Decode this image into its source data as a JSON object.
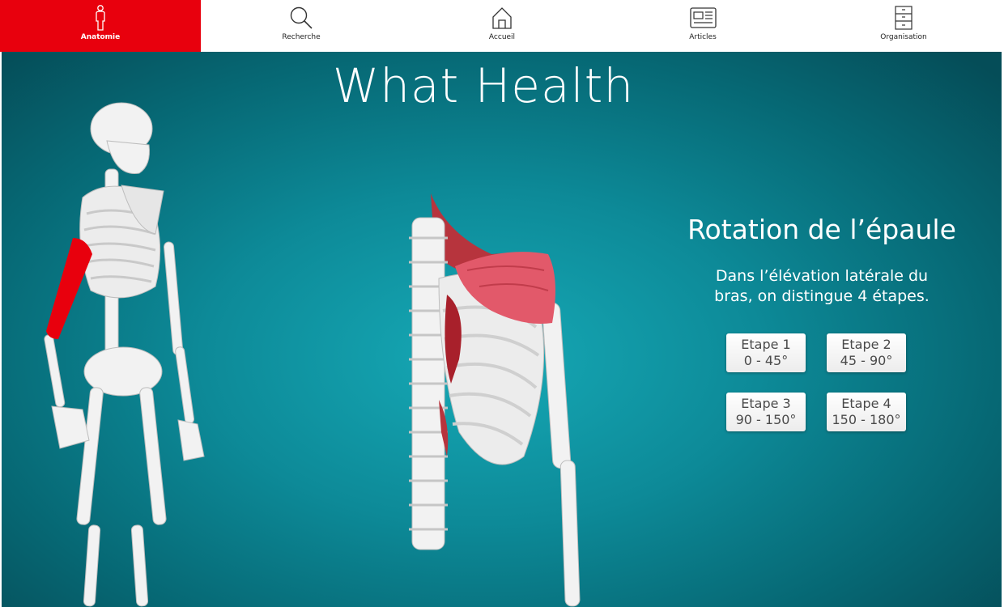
{
  "nav": {
    "items": [
      {
        "label": "Anatomie",
        "icon": "person-icon",
        "active": true
      },
      {
        "label": "Recherche",
        "icon": "search-icon",
        "active": false
      },
      {
        "label": "Accueil",
        "icon": "home-icon",
        "active": false
      },
      {
        "label": "Articles",
        "icon": "newspaper-icon",
        "active": false
      },
      {
        "label": "Organisation",
        "icon": "cabinet-icon",
        "active": false
      }
    ]
  },
  "scene": {
    "title": "What Health",
    "topic_title": "Rotation de l’épaule",
    "description_line1": "Dans l’élévation latérale du",
    "description_line2": "bras, on distingue 4 étapes.",
    "steps": [
      {
        "name": "Etape 1",
        "range": "0 - 45°"
      },
      {
        "name": "Etape 2",
        "range": "45 - 90°"
      },
      {
        "name": "Etape 3",
        "range": "90 - 150°"
      },
      {
        "name": "Etape 4",
        "range": "150 - 180°"
      }
    ]
  },
  "colors": {
    "accent": "#e8000d",
    "background_center": "#16a9b6",
    "background_edge": "#054d58",
    "muscle": "#e2596a"
  }
}
